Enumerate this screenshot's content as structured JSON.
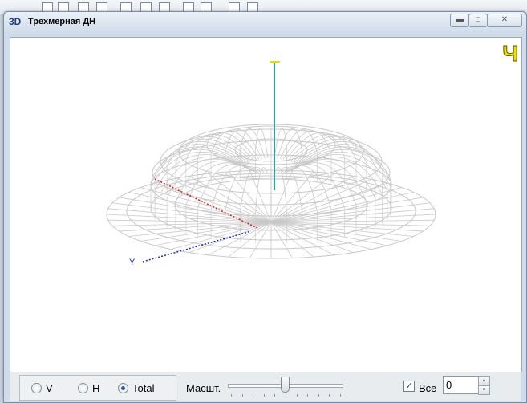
{
  "window": {
    "icon_text": "3D",
    "title": "Трехмерная ДН"
  },
  "viewport": {
    "corner_glyph": "Ч",
    "axis_y_label": "Y"
  },
  "controls": {
    "modes": [
      {
        "label": "V",
        "selected": false
      },
      {
        "label": "H",
        "selected": false
      },
      {
        "label": "Total",
        "selected": true
      }
    ],
    "scale_label": "Масшт.",
    "scale_value": 0.5,
    "all_checked": true,
    "all_label": "Все",
    "count_value": "0"
  },
  "colors": {
    "mesh": "#c8c8c8",
    "axis_z": "#2aa0a8",
    "axis_x": "#d02020",
    "axis_y": "#1a2ab0",
    "corner_glyph": "#f0e000"
  },
  "icons": [
    "minimize-icon",
    "maximize-icon",
    "close-icon",
    "spin-up-icon",
    "spin-down-icon"
  ]
}
